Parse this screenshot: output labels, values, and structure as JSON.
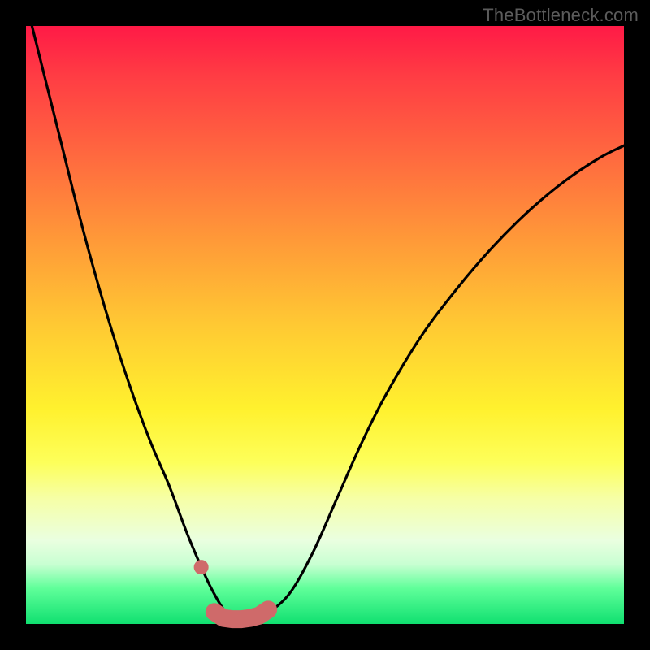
{
  "watermark": "TheBottleneck.com",
  "colors": {
    "frame": "#000000",
    "curve": "#000000",
    "marker": "#cf6a6a"
  },
  "chart_data": {
    "type": "line",
    "title": "",
    "xlabel": "",
    "ylabel": "",
    "xlim": [
      0,
      100
    ],
    "ylim": [
      0,
      100
    ],
    "grid": false,
    "legend": false,
    "x": [
      0,
      3,
      6,
      9,
      12,
      15,
      18,
      21,
      24,
      27,
      30,
      31.5,
      33,
      34.5,
      36,
      38,
      40,
      44,
      48,
      52,
      56,
      60,
      66,
      72,
      78,
      84,
      90,
      96,
      100
    ],
    "values": [
      104,
      92,
      80,
      68,
      57,
      47,
      38,
      30,
      23,
      15,
      8,
      5,
      2.5,
      1,
      0.5,
      0.5,
      1.5,
      5,
      12,
      21,
      30,
      38,
      48,
      56,
      63,
      69,
      74,
      78,
      80
    ],
    "markers": {
      "x": [
        29.3,
        31.5,
        33.0,
        34.5,
        36.0,
        37.5,
        39.0,
        40.5
      ],
      "y": [
        9.5,
        2.0,
        1.0,
        0.8,
        0.8,
        1.0,
        1.4,
        2.4
      ]
    }
  }
}
